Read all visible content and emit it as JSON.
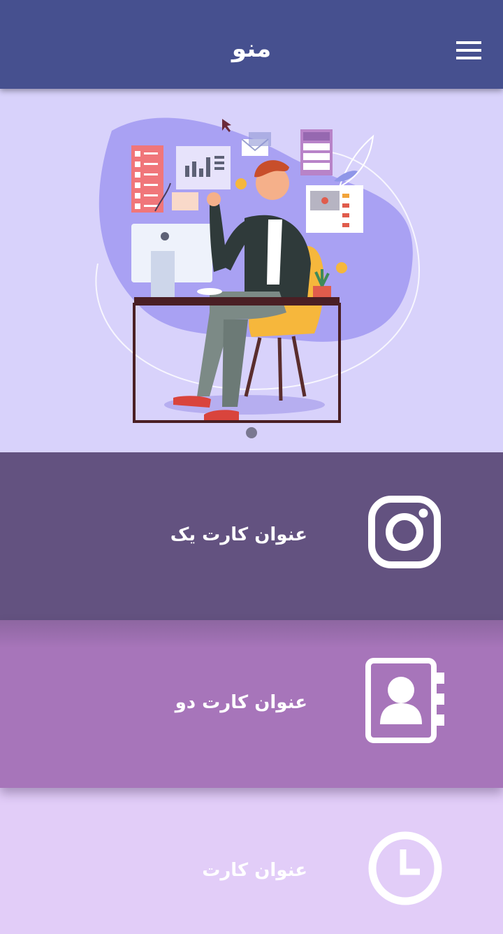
{
  "appbar": {
    "title": "منو",
    "menu_icon": "hamburger-icon",
    "background": "#46508f"
  },
  "hero": {
    "background": "#d8d2fb",
    "image": "person-at-desk-illustration",
    "pager_dot_color": "#7a7891"
  },
  "cards": [
    {
      "title": "عنوان کارت یک",
      "icon": "instagram-icon",
      "background": "#635280"
    },
    {
      "title": "عنوان کارت دو",
      "icon": "contact-book-icon",
      "background": "#a775ba"
    },
    {
      "title": "عنوان کارت",
      "icon": "clock-icon",
      "background": "#e2cdf8"
    }
  ]
}
